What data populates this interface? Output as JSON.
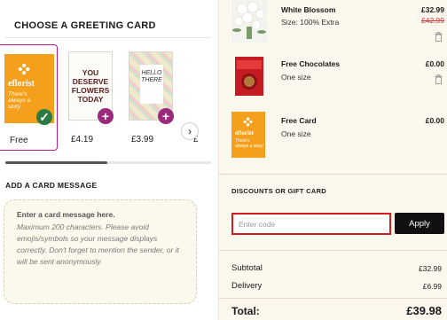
{
  "greeting": {
    "title": "CHOOSE A GREETING CARD",
    "cards": [
      {
        "logo": "eflorist",
        "text": "There's always a story",
        "price": "Free",
        "selected": true
      },
      {
        "text": "YOU DESERVE FLOWERS TODAY",
        "price": "£4.19"
      },
      {
        "text": "HELLO THERE",
        "price": "£3.99"
      },
      {
        "price": "£"
      }
    ],
    "next_icon": "chevron-right-icon"
  },
  "message": {
    "title": "ADD A CARD MESSAGE",
    "heading": "Enter a card message here.",
    "hint": "Maximum 200 characters. Please avoid emojis/symbols so your message displays correctly. Don't forget to mention the sender, or it will be sent anonymously."
  },
  "basket": {
    "items": [
      {
        "name": "White Blossom",
        "sub": "Size: 100% Extra",
        "price": "£32.99",
        "old_price": "£42.99"
      },
      {
        "name": "Free Chocolates",
        "sub": "One size",
        "price": "£0.00"
      },
      {
        "name": "Free Card",
        "sub": "One size",
        "price": "£0.00",
        "logo": "eflorist",
        "card_text": "There's always a story"
      }
    ]
  },
  "discount": {
    "title": "DISCOUNTS OR GIFT CARD",
    "placeholder": "Enter code",
    "apply": "Apply"
  },
  "summary": {
    "subtotal_label": "Subtotal",
    "subtotal": "£32.99",
    "delivery_label": "Delivery",
    "delivery": "£6.99",
    "total_label": "Total:",
    "total": "£39.98"
  }
}
